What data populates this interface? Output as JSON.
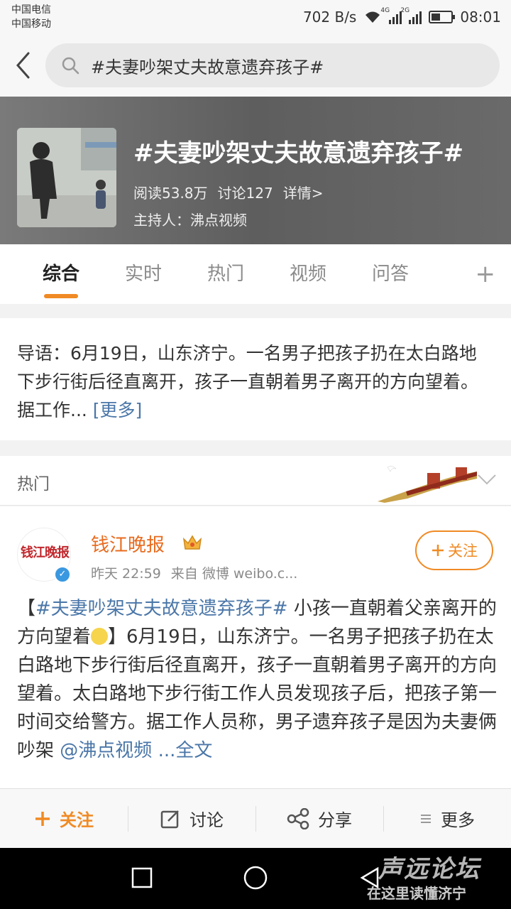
{
  "status_bar": {
    "carrier_1": "中国电信",
    "carrier_2": "中国移动",
    "net_speed": "702 B/s",
    "sig1_tag": "4G",
    "sig2_tag": "2G",
    "battery_level": 0.45,
    "time": "08:01"
  },
  "search": {
    "query": "#夫妻吵架丈夫故意遗弃孩子#"
  },
  "banner": {
    "title": "#夫妻吵架丈夫故意遗弃孩子#",
    "reads": "阅读53.8万",
    "discussions": "讨论127",
    "details": "详情>",
    "host": "主持人：沸点视频"
  },
  "tabs": {
    "items": [
      "综合",
      "实时",
      "热门",
      "视频",
      "问答"
    ],
    "active_index": 0,
    "add": "+"
  },
  "intro": {
    "text": "导语：6月19日，山东济宁。一名男子把孩子扔在太白路地下步行街后径直离开，孩子一直朝着男子离开的方向望着。据工作...",
    "more": "[更多]"
  },
  "hot": {
    "label": "热门"
  },
  "post": {
    "avatar_text": "钱江晚报",
    "author": "钱江晚报",
    "time": "昨天 22:59",
    "source": "来自 微博 weibo.c...",
    "follow": "关注",
    "bracket_open": "【",
    "topic": "#夫妻吵架丈夫故意遗弃孩子#",
    "text_a": " 小孩一直朝着父亲离开的方向望着",
    "text_b": "】6月19日，山东济宁。一名男子把孩子扔在太白路地下步行街后径直离开，孩子一直朝着男子离开的方向望着。太白路地下步行街工作人员发现孩子后，把孩子第一时间交给警方。据工作人员称，男子遗弃孩子是因为夫妻俩吵架",
    "mention": "@沸点视频",
    "full_text": "...全文"
  },
  "toolbar": {
    "follow": "关注",
    "comment": "讨论",
    "share": "分享",
    "more": "更多"
  },
  "watermark": {
    "top": "声远论坛",
    "bottom": "在这里读懂济宁"
  },
  "colors": {
    "accent": "#f08a24",
    "link": "#4a76a8",
    "author": "#e86b1e"
  }
}
